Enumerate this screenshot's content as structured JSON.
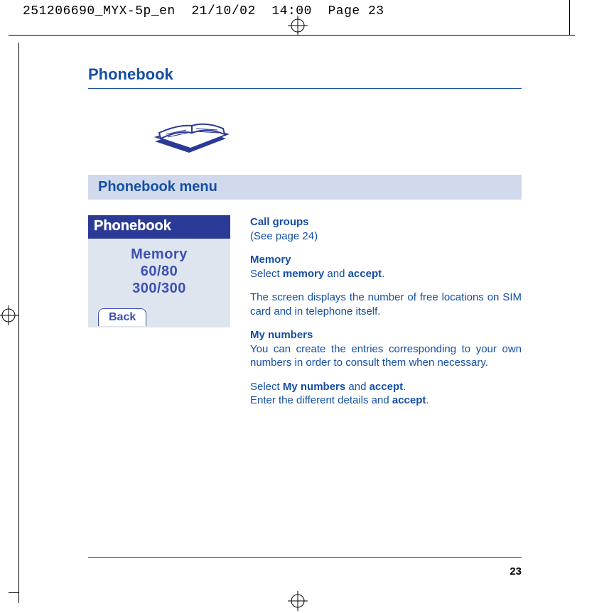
{
  "imprint": {
    "filecode": "251206690_MYX-5p_en",
    "date": "21/10/02",
    "time": "14:00",
    "page_label": "Page 23"
  },
  "title": "Phonebook",
  "section_heading": "Phonebook menu",
  "phone_screen": {
    "title": "Phonebook",
    "line1": "Memory",
    "line2": "60/80",
    "line3": "300/300",
    "softkey": "Back"
  },
  "body": {
    "call_groups_h": "Call groups",
    "call_groups_ref": "(See page 24)",
    "memory_h": "Memory",
    "memory_select_pre": "Select ",
    "memory_select_b1": "memory",
    "memory_select_mid": " and ",
    "memory_select_b2": "accept",
    "memory_select_post": ".",
    "memory_desc": "The screen displays the number of free locations on SIM card and in telephone itself.",
    "mynum_h": "My numbers",
    "mynum_desc": "You can create the entries corresponding to your own numbers in order to consult them when necessary.",
    "mynum_sel_pre": "Select ",
    "mynum_sel_b1": "My numbers",
    "mynum_sel_mid": " and ",
    "mynum_sel_b2": "accept",
    "mynum_sel_post": ".",
    "mynum_enter_pre": "Enter the different details and ",
    "mynum_enter_b": "accept",
    "mynum_enter_post": "."
  },
  "page_number": "23"
}
